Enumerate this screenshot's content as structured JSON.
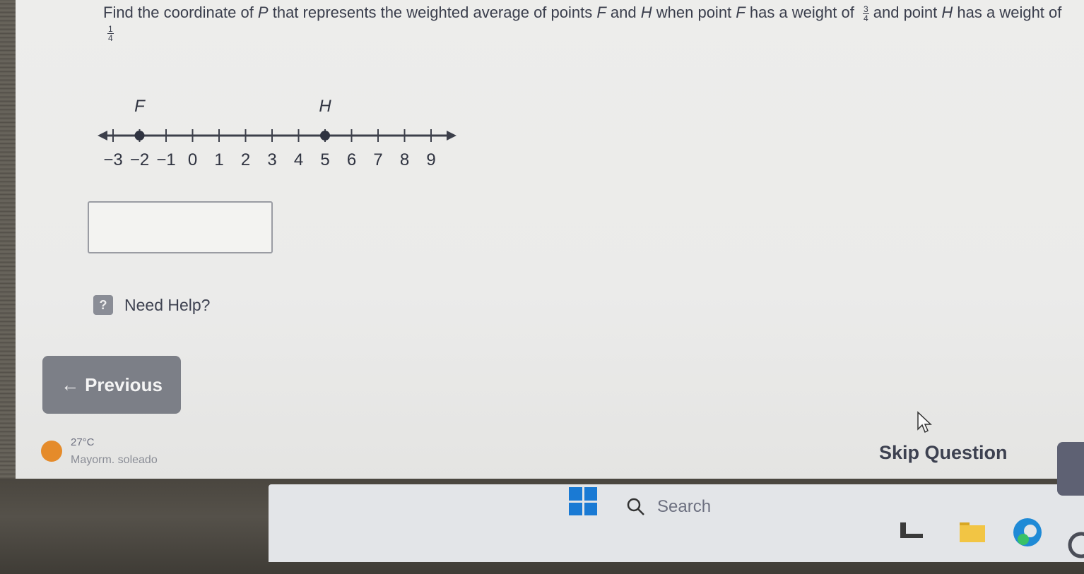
{
  "question": {
    "part1": "Find the coordinate of ",
    "var_p": "P",
    "part2": " that represents the weighted average of points ",
    "var_f": "F",
    "part3": " and ",
    "var_h": "H",
    "part4": " when point ",
    "var_f2": "F",
    "part5": " has a weight of ",
    "f_weight_num": "3",
    "f_weight_den": "4",
    "part6": " and point ",
    "var_h2": "H",
    "part7": " has a weight of ",
    "h_weight_num": "1",
    "h_weight_den": "4"
  },
  "number_line": {
    "min": -3,
    "max": 9,
    "tick_labels": [
      "−3",
      "−2",
      "−1",
      "0",
      "1",
      "2",
      "3",
      "4",
      "5",
      "6",
      "7",
      "8",
      "9"
    ],
    "points": [
      {
        "label": "F",
        "value": -2
      },
      {
        "label": "H",
        "value": 5
      }
    ]
  },
  "answer": {
    "value": ""
  },
  "help": {
    "icon_text": "?",
    "label": "Need Help?"
  },
  "nav": {
    "previous_label": "Previous",
    "previous_arrow": "←",
    "skip_label": "Skip Question"
  },
  "weather": {
    "temp": "27°C",
    "desc": "Mayorm. soleado"
  },
  "taskbar": {
    "search_label": "Search"
  },
  "colors": {
    "windows_blue": "#1a7ad4",
    "button_gray": "#7c7f87"
  }
}
